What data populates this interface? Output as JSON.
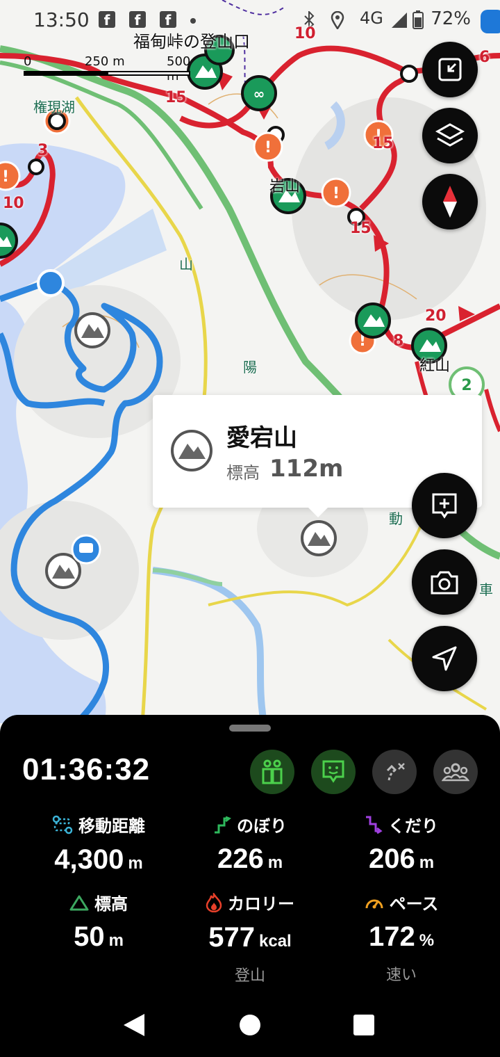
{
  "status_bar": {
    "time": "13:50",
    "fb_icon_label": "f",
    "network": "4G",
    "battery": "72%",
    "icons": [
      "facebook-icon",
      "facebook-icon",
      "facebook-icon",
      "bluetooth-icon",
      "location-icon",
      "signal-icon",
      "battery-icon"
    ]
  },
  "map": {
    "scale": {
      "zero": "0",
      "mid": "250 m",
      "max": "500 m"
    },
    "place_labels": [
      "福甸峠の登山口",
      "権現湖",
      "岩山",
      "紅山"
    ],
    "road_labels": [
      "山",
      "陽",
      "動",
      "車"
    ],
    "route_numbers": [
      "10",
      "6",
      "15",
      "8",
      "15",
      "3",
      "10",
      "15",
      "20",
      "8"
    ],
    "accent_red": "#d9222f",
    "track_blue": "#2e86de"
  },
  "popup": {
    "title": "愛宕山",
    "elevation_label": "標高",
    "elevation_value": "112m"
  },
  "side_buttons": [
    "fullscreen-exit-icon",
    "layers-icon",
    "compass-icon",
    "add-note-icon",
    "camera-icon",
    "navigate-icon"
  ],
  "panel": {
    "timer": "01:36:32",
    "buttons": [
      "companion-icon",
      "smile-chat-icon",
      "route-off-icon",
      "group-icon"
    ],
    "stats": [
      {
        "label": "移動距離",
        "value": "4,300",
        "unit": "m",
        "icon": "distance-icon",
        "icon_color": "#3cb4d8"
      },
      {
        "label": "のぼり",
        "value": "226",
        "unit": "m",
        "icon": "ascent-icon",
        "icon_color": "#2eb85c"
      },
      {
        "label": "くだり",
        "value": "206",
        "unit": "m",
        "icon": "descent-icon",
        "icon_color": "#a040e0"
      },
      {
        "label": "標高",
        "value": "50",
        "unit": "m",
        "icon": "elevation-icon",
        "icon_color": "#3ca860"
      },
      {
        "label": "カロリー",
        "value": "577",
        "unit": "kcal",
        "icon": "calorie-icon",
        "icon_color": "#e8402a",
        "sub": "登山"
      },
      {
        "label": "ペース",
        "value": "172",
        "unit": "%",
        "icon": "pace-icon",
        "icon_color": "#f0a020",
        "sub": "速い"
      }
    ]
  },
  "nav_bar": [
    "back-icon",
    "home-icon",
    "recents-icon"
  ]
}
